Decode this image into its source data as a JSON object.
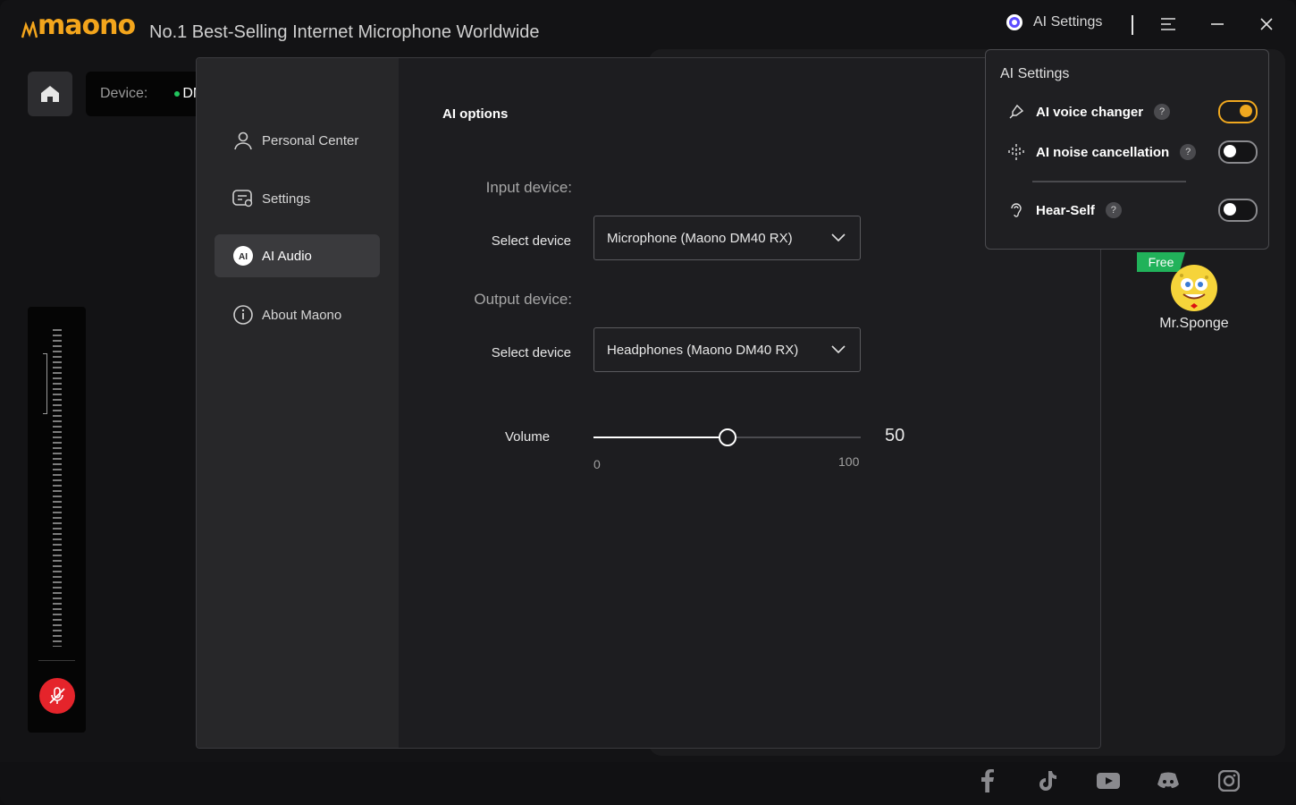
{
  "header": {
    "logo_text": "maono",
    "tagline": "No.1 Best-Selling Internet Microphone Worldwide",
    "ai_settings_label": "AI Settings",
    "ai_badge": "AI"
  },
  "device": {
    "label": "Device:",
    "value": "DM"
  },
  "nav": {
    "items": [
      {
        "label": "Personal Center",
        "icon": "user-icon"
      },
      {
        "label": "Settings",
        "icon": "settings-icon"
      },
      {
        "label": "AI Audio",
        "icon": "ai-icon",
        "active": true,
        "badge": "AI"
      },
      {
        "label": "About Maono",
        "icon": "info-icon"
      }
    ]
  },
  "content": {
    "section_title": "AI options",
    "input_device_label": "Input device:",
    "input_select_label": "Select device",
    "input_device_value": "Microphone (Maono DM40 RX)",
    "output_device_label": "Output device:",
    "output_select_label": "Select device",
    "output_device_value": "Headphones (Maono DM40 RX)",
    "volume_label": "Volume",
    "volume_value": "50",
    "volume_min": "0",
    "volume_max": "100",
    "volume_fraction": 0.5
  },
  "ai_settings_popover": {
    "title": "AI Settings",
    "help_glyph": "?",
    "items": [
      {
        "label": "AI voice changer",
        "enabled": true,
        "icon": "voice-changer-icon"
      },
      {
        "label": "AI noise cancellation",
        "enabled": false,
        "icon": "noise-cancel-icon"
      },
      {
        "label": "Hear-Self",
        "enabled": false,
        "icon": "hear-self-icon"
      }
    ]
  },
  "voice_character": {
    "tag": "Free",
    "name": "Mr.Sponge"
  },
  "social": [
    "facebook-icon",
    "tiktok-icon",
    "youtube-icon",
    "discord-icon",
    "instagram-icon"
  ],
  "colors": {
    "accent": "#f0a81f",
    "mute": "#e5242b",
    "free": "#21b25a"
  }
}
